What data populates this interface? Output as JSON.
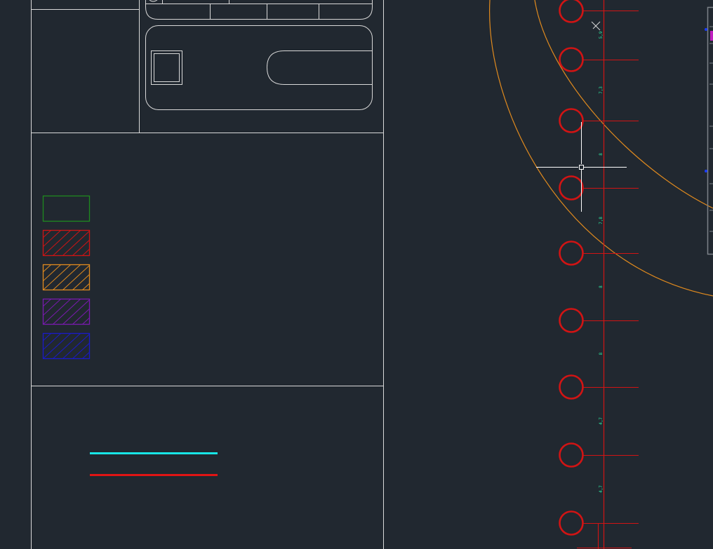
{
  "viewport": {
    "background": "#212830",
    "linework_color": "#d9d9d9"
  },
  "legend": {
    "swatches": [
      {
        "color": "#1f8a1f",
        "hatched": false
      },
      {
        "color": "#d11414",
        "hatched": true
      },
      {
        "color": "#e08a1e",
        "hatched": true
      },
      {
        "color": "#7a1ab0",
        "hatched": true
      },
      {
        "color": "#1a1ac8",
        "hatched": true
      }
    ],
    "lines": [
      {
        "color": "#18e6e6"
      },
      {
        "color": "#e01414"
      }
    ]
  },
  "column_grid": {
    "column_color": "#d11414",
    "orbit_color": "#e08a1e",
    "dimension_color": "#2ee8a0",
    "column_count": 9,
    "dimensions": [
      "5,9",
      "7,3",
      "8",
      "7,8",
      "8",
      "8",
      "4,7",
      "4,7"
    ]
  },
  "cursor": {
    "type": "crosshair-pickbox",
    "color": "#ffffff"
  },
  "side_panel": {
    "marker_color": "#1a3cff",
    "accent_color": "#c020c0"
  }
}
